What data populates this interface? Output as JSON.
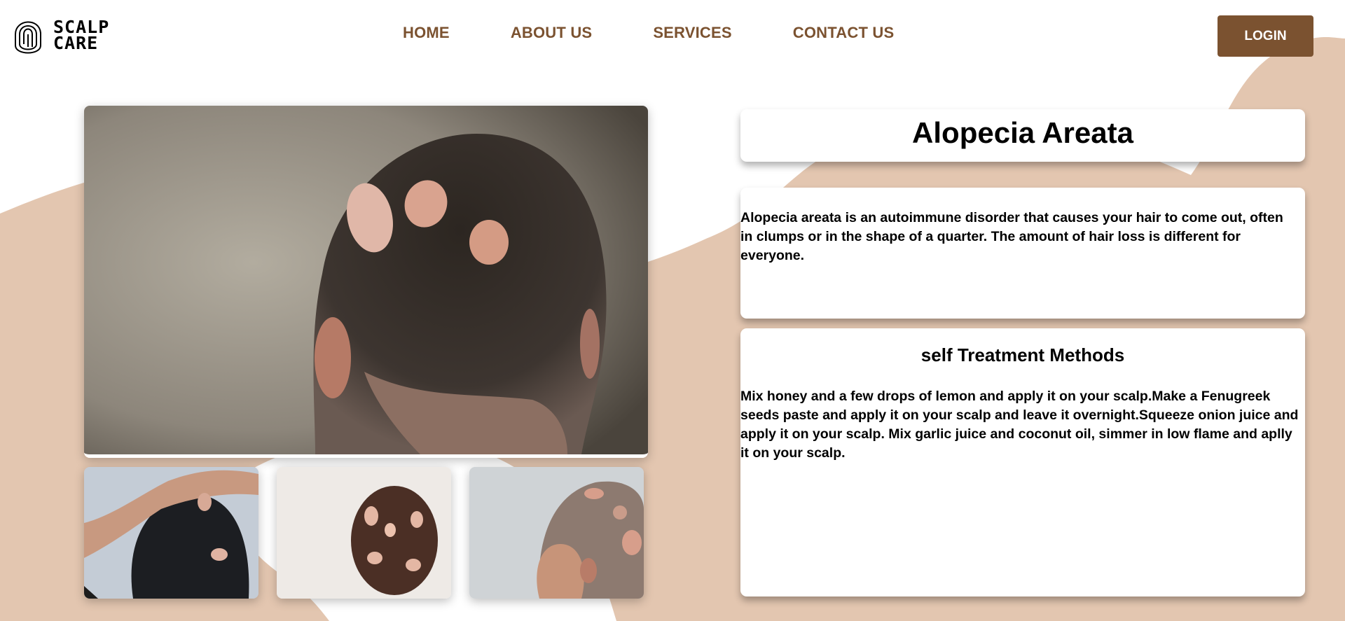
{
  "brand": {
    "line1": "SCALP",
    "line2": "CARE"
  },
  "nav": [
    {
      "label": "HOME"
    },
    {
      "label": "ABOUT US"
    },
    {
      "label": "SERVICES"
    },
    {
      "label": "CONTACT US"
    }
  ],
  "login_label": "LOGIN",
  "condition": {
    "title": "Alopecia Areata",
    "description": "Alopecia areata is an autoimmune disorder that causes your hair to come out, often in clumps or in the shape of a quarter. The amount of hair loss is different for everyone.",
    "treatment_heading": "self Treatment Methods",
    "treatment_text": "Mix honey and a few drops of lemon and apply it on your scalp.Make a Fenugreek seeds paste and apply it on your scalp and leave it overnight.Squeeze onion juice and apply it on your scalp. Mix garlic juice and coconut oil, simmer in low flame and aplly it on your scalp."
  },
  "colors": {
    "brand": "#7b5230",
    "blob": "#e3c6b0",
    "background": "#ffffff"
  }
}
